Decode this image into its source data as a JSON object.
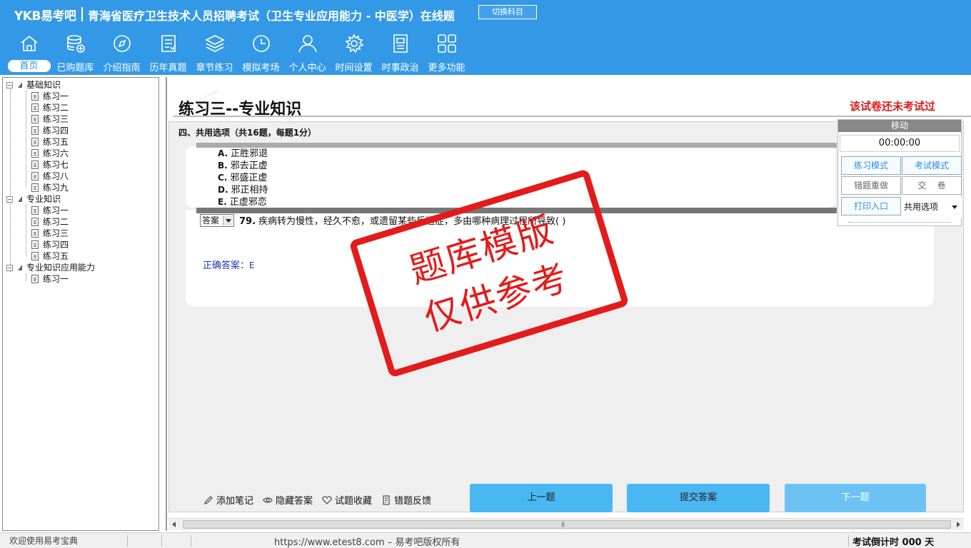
{
  "header": {
    "brand": "YKB易考吧",
    "title": "青海省医疗卫生技术人员招聘考试（卫生专业应用能力 - 中医学）在线题",
    "switch_subject": "切换科目"
  },
  "nav": [
    {
      "label": "首页",
      "icon": "home-icon"
    },
    {
      "label": "已购题库",
      "icon": "database-icon"
    },
    {
      "label": "介绍指南",
      "icon": "compass-icon"
    },
    {
      "label": "历年真题",
      "icon": "document-list-icon"
    },
    {
      "label": "章节练习",
      "icon": "layers-icon"
    },
    {
      "label": "模拟考场",
      "icon": "clock-icon"
    },
    {
      "label": "个人中心",
      "icon": "user-icon"
    },
    {
      "label": "时间设置",
      "icon": "gear-icon"
    },
    {
      "label": "时事政治",
      "icon": "newspaper-icon"
    },
    {
      "label": "更多功能",
      "icon": "grid-icon"
    }
  ],
  "tree": {
    "groups": [
      {
        "label": "基础知识",
        "items": [
          "练习一",
          "练习二",
          "练习三",
          "练习四",
          "练习五",
          "练习六",
          "练习七",
          "练习八",
          "练习九"
        ]
      },
      {
        "label": "专业知识",
        "items": [
          "练习一",
          "练习二",
          "练习三",
          "练习四",
          "练习五"
        ]
      },
      {
        "label": "专业知识应用能力",
        "items": [
          "练习一"
        ]
      }
    ]
  },
  "page": {
    "title": "练习三--专业知识",
    "status": "该试卷还未考试过",
    "section": "四、共用选项（共16题，每题1分）"
  },
  "options": [
    {
      "letter": "A.",
      "text": "正胜邪退"
    },
    {
      "letter": "B.",
      "text": "邪去正虚"
    },
    {
      "letter": "C.",
      "text": "邪盛正虚"
    },
    {
      "letter": "D.",
      "text": "邪正相持"
    },
    {
      "letter": "E.",
      "text": "正虚邪恋"
    }
  ],
  "question": {
    "answer_select": "答案",
    "number": "79.",
    "text": "疾病转为慢性，经久不愈，或遗留某些后遗症，多由哪种病理过程所导致(  )",
    "correct_answer_label": "正确答案：",
    "correct_answer_value": "E"
  },
  "stamp": {
    "line1": "题库模版",
    "line2": "仅供参考",
    "color": "#e31b1b"
  },
  "panel": {
    "move": "移动",
    "timer": "00:00:00",
    "practice_mode": "练习模式",
    "exam_mode": "考试模式",
    "redo_wrong": "错题重做",
    "submit_paper": "交    卷",
    "print": "打印入口",
    "shared_option": "共用选项"
  },
  "toolbar": {
    "add_note": "添加笔记",
    "hide_answer": "隐藏答案",
    "favorite": "试题收藏",
    "feedback": "错题反馈",
    "prev": "上一题",
    "submit": "提交答案",
    "next": "下一题"
  },
  "statusbar": {
    "welcome": "欢迎使用易考宝典",
    "url": "https://www.etest8.com – 易考吧版权所有",
    "countdown": "考试倒计时 000 天"
  },
  "colors": {
    "header_bg": "#3399e6",
    "button_bg": "#49b7f2",
    "status_red": "#d81c1c"
  }
}
